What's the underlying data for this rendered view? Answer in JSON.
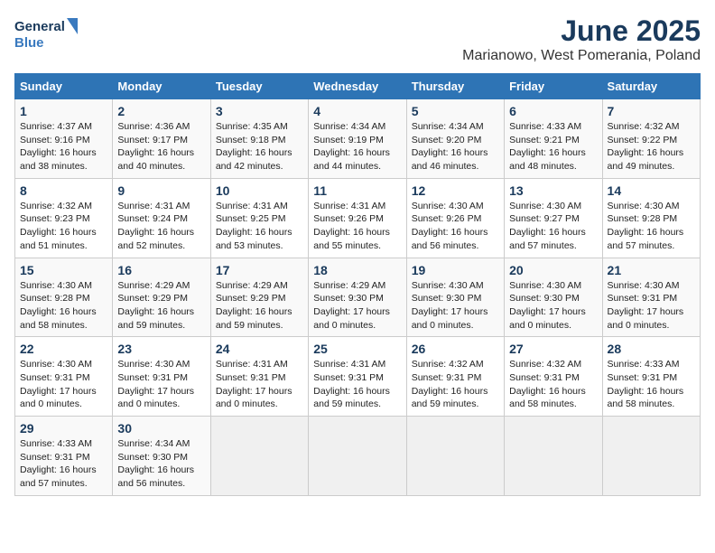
{
  "logo": {
    "line1": "General",
    "line2": "Blue"
  },
  "title": "June 2025",
  "subtitle": "Marianowo, West Pomerania, Poland",
  "weekdays": [
    "Sunday",
    "Monday",
    "Tuesday",
    "Wednesday",
    "Thursday",
    "Friday",
    "Saturday"
  ],
  "weeks": [
    [
      {
        "day": "1",
        "sunrise": "Sunrise: 4:37 AM",
        "sunset": "Sunset: 9:16 PM",
        "daylight": "Daylight: 16 hours and 38 minutes."
      },
      {
        "day": "2",
        "sunrise": "Sunrise: 4:36 AM",
        "sunset": "Sunset: 9:17 PM",
        "daylight": "Daylight: 16 hours and 40 minutes."
      },
      {
        "day": "3",
        "sunrise": "Sunrise: 4:35 AM",
        "sunset": "Sunset: 9:18 PM",
        "daylight": "Daylight: 16 hours and 42 minutes."
      },
      {
        "day": "4",
        "sunrise": "Sunrise: 4:34 AM",
        "sunset": "Sunset: 9:19 PM",
        "daylight": "Daylight: 16 hours and 44 minutes."
      },
      {
        "day": "5",
        "sunrise": "Sunrise: 4:34 AM",
        "sunset": "Sunset: 9:20 PM",
        "daylight": "Daylight: 16 hours and 46 minutes."
      },
      {
        "day": "6",
        "sunrise": "Sunrise: 4:33 AM",
        "sunset": "Sunset: 9:21 PM",
        "daylight": "Daylight: 16 hours and 48 minutes."
      },
      {
        "day": "7",
        "sunrise": "Sunrise: 4:32 AM",
        "sunset": "Sunset: 9:22 PM",
        "daylight": "Daylight: 16 hours and 49 minutes."
      }
    ],
    [
      {
        "day": "8",
        "sunrise": "Sunrise: 4:32 AM",
        "sunset": "Sunset: 9:23 PM",
        "daylight": "Daylight: 16 hours and 51 minutes."
      },
      {
        "day": "9",
        "sunrise": "Sunrise: 4:31 AM",
        "sunset": "Sunset: 9:24 PM",
        "daylight": "Daylight: 16 hours and 52 minutes."
      },
      {
        "day": "10",
        "sunrise": "Sunrise: 4:31 AM",
        "sunset": "Sunset: 9:25 PM",
        "daylight": "Daylight: 16 hours and 53 minutes."
      },
      {
        "day": "11",
        "sunrise": "Sunrise: 4:31 AM",
        "sunset": "Sunset: 9:26 PM",
        "daylight": "Daylight: 16 hours and 55 minutes."
      },
      {
        "day": "12",
        "sunrise": "Sunrise: 4:30 AM",
        "sunset": "Sunset: 9:26 PM",
        "daylight": "Daylight: 16 hours and 56 minutes."
      },
      {
        "day": "13",
        "sunrise": "Sunrise: 4:30 AM",
        "sunset": "Sunset: 9:27 PM",
        "daylight": "Daylight: 16 hours and 57 minutes."
      },
      {
        "day": "14",
        "sunrise": "Sunrise: 4:30 AM",
        "sunset": "Sunset: 9:28 PM",
        "daylight": "Daylight: 16 hours and 57 minutes."
      }
    ],
    [
      {
        "day": "15",
        "sunrise": "Sunrise: 4:30 AM",
        "sunset": "Sunset: 9:28 PM",
        "daylight": "Daylight: 16 hours and 58 minutes."
      },
      {
        "day": "16",
        "sunrise": "Sunrise: 4:29 AM",
        "sunset": "Sunset: 9:29 PM",
        "daylight": "Daylight: 16 hours and 59 minutes."
      },
      {
        "day": "17",
        "sunrise": "Sunrise: 4:29 AM",
        "sunset": "Sunset: 9:29 PM",
        "daylight": "Daylight: 16 hours and 59 minutes."
      },
      {
        "day": "18",
        "sunrise": "Sunrise: 4:29 AM",
        "sunset": "Sunset: 9:30 PM",
        "daylight": "Daylight: 17 hours and 0 minutes."
      },
      {
        "day": "19",
        "sunrise": "Sunrise: 4:30 AM",
        "sunset": "Sunset: 9:30 PM",
        "daylight": "Daylight: 17 hours and 0 minutes."
      },
      {
        "day": "20",
        "sunrise": "Sunrise: 4:30 AM",
        "sunset": "Sunset: 9:30 PM",
        "daylight": "Daylight: 17 hours and 0 minutes."
      },
      {
        "day": "21",
        "sunrise": "Sunrise: 4:30 AM",
        "sunset": "Sunset: 9:31 PM",
        "daylight": "Daylight: 17 hours and 0 minutes."
      }
    ],
    [
      {
        "day": "22",
        "sunrise": "Sunrise: 4:30 AM",
        "sunset": "Sunset: 9:31 PM",
        "daylight": "Daylight: 17 hours and 0 minutes."
      },
      {
        "day": "23",
        "sunrise": "Sunrise: 4:30 AM",
        "sunset": "Sunset: 9:31 PM",
        "daylight": "Daylight: 17 hours and 0 minutes."
      },
      {
        "day": "24",
        "sunrise": "Sunrise: 4:31 AM",
        "sunset": "Sunset: 9:31 PM",
        "daylight": "Daylight: 17 hours and 0 minutes."
      },
      {
        "day": "25",
        "sunrise": "Sunrise: 4:31 AM",
        "sunset": "Sunset: 9:31 PM",
        "daylight": "Daylight: 16 hours and 59 minutes."
      },
      {
        "day": "26",
        "sunrise": "Sunrise: 4:32 AM",
        "sunset": "Sunset: 9:31 PM",
        "daylight": "Daylight: 16 hours and 59 minutes."
      },
      {
        "day": "27",
        "sunrise": "Sunrise: 4:32 AM",
        "sunset": "Sunset: 9:31 PM",
        "daylight": "Daylight: 16 hours and 58 minutes."
      },
      {
        "day": "28",
        "sunrise": "Sunrise: 4:33 AM",
        "sunset": "Sunset: 9:31 PM",
        "daylight": "Daylight: 16 hours and 58 minutes."
      }
    ],
    [
      {
        "day": "29",
        "sunrise": "Sunrise: 4:33 AM",
        "sunset": "Sunset: 9:31 PM",
        "daylight": "Daylight: 16 hours and 57 minutes."
      },
      {
        "day": "30",
        "sunrise": "Sunrise: 4:34 AM",
        "sunset": "Sunset: 9:30 PM",
        "daylight": "Daylight: 16 hours and 56 minutes."
      },
      null,
      null,
      null,
      null,
      null
    ]
  ]
}
